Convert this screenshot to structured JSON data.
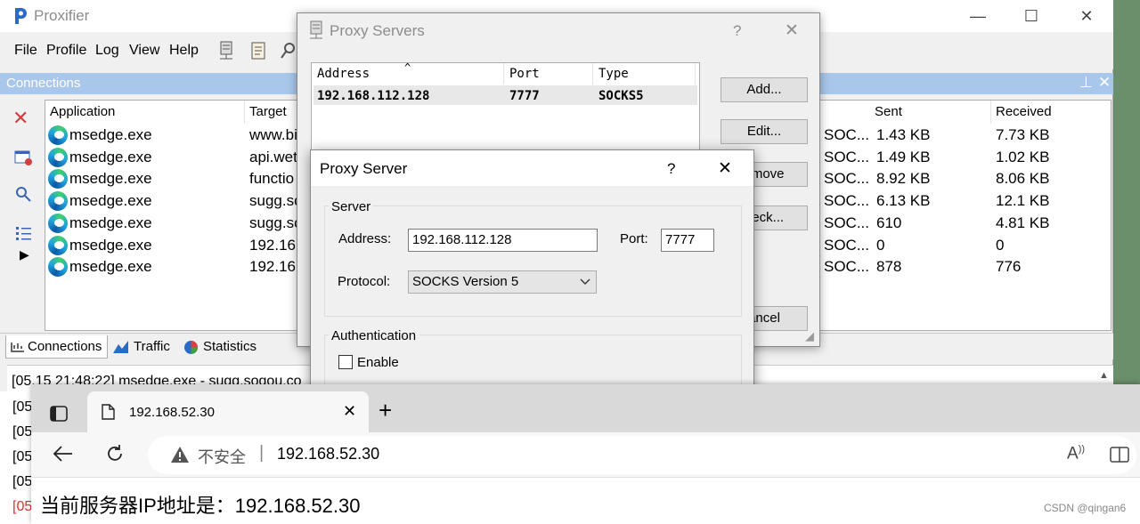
{
  "proxifier": {
    "title": "Proxifier",
    "menu": [
      "File",
      "Profile",
      "Log",
      "View",
      "Help"
    ],
    "panel_title": "Connections",
    "columns": [
      "Application",
      "Target",
      "Sent",
      "Received"
    ],
    "rows": [
      {
        "app": "msedge.exe",
        "target": "www.bi",
        "proxy": "SOC...",
        "sent": "1.43 KB",
        "received": "7.73 KB"
      },
      {
        "app": "msedge.exe",
        "target": "api.wet",
        "proxy": "SOC...",
        "sent": "1.49 KB",
        "received": "1.02 KB"
      },
      {
        "app": "msedge.exe",
        "target": "functio",
        "proxy": "SOC...",
        "sent": "8.92 KB",
        "received": "8.06 KB"
      },
      {
        "app": "msedge.exe",
        "target": "sugg.sc",
        "proxy": "SOC...",
        "sent": "6.13 KB",
        "received": "12.1 KB"
      },
      {
        "app": "msedge.exe",
        "target": "sugg.sc",
        "proxy": "SOC...",
        "sent": "610",
        "received": "4.81 KB"
      },
      {
        "app": "msedge.exe",
        "target": "192.16",
        "proxy": "SOC...",
        "sent": "0",
        "received": "0"
      },
      {
        "app": "msedge.exe",
        "target": "192.16",
        "proxy": "SOC...",
        "sent": "878",
        "received": "776"
      }
    ],
    "bottom_tabs": [
      "Connections",
      "Traffic",
      "Statistics"
    ],
    "log_line": "[05.15 21:48:22] msedge.exe - sugg.sogou.co",
    "log_prefixes": [
      "[05",
      "[05",
      "[05",
      "[05",
      "[05"
    ]
  },
  "proxy_servers_dialog": {
    "title": "Proxy Servers",
    "help": "?",
    "columns": [
      "Address",
      "Port",
      "Type"
    ],
    "row": {
      "address": "192.168.112.128",
      "port": "7777",
      "type": "SOCKS5"
    },
    "buttons": [
      "Add...",
      "Edit...",
      "emove",
      "heck...",
      "ancel"
    ]
  },
  "proxy_server_dialog": {
    "title": "Proxy Server",
    "help": "?",
    "server_group": "Server",
    "address_label": "Address:",
    "address_value": "192.168.112.128",
    "port_label": "Port:",
    "port_value": "7777",
    "protocol_label": "Protocol:",
    "protocol_value": "SOCKS Version 5",
    "auth_group": "Authentication",
    "enable_label": "Enable",
    "enable_checked": false
  },
  "browser": {
    "tab_title": "192.168.52.30",
    "security_label": "不安全",
    "address": "192.168.52.30",
    "page_text": "当前服务器IP地址是：192.168.52.30"
  },
  "watermark": "CSDN @qingan6",
  "colors": {
    "panel_header": "#a9c7eb",
    "log_error": "#e03030",
    "edge_blue": "#1fa2e0"
  }
}
